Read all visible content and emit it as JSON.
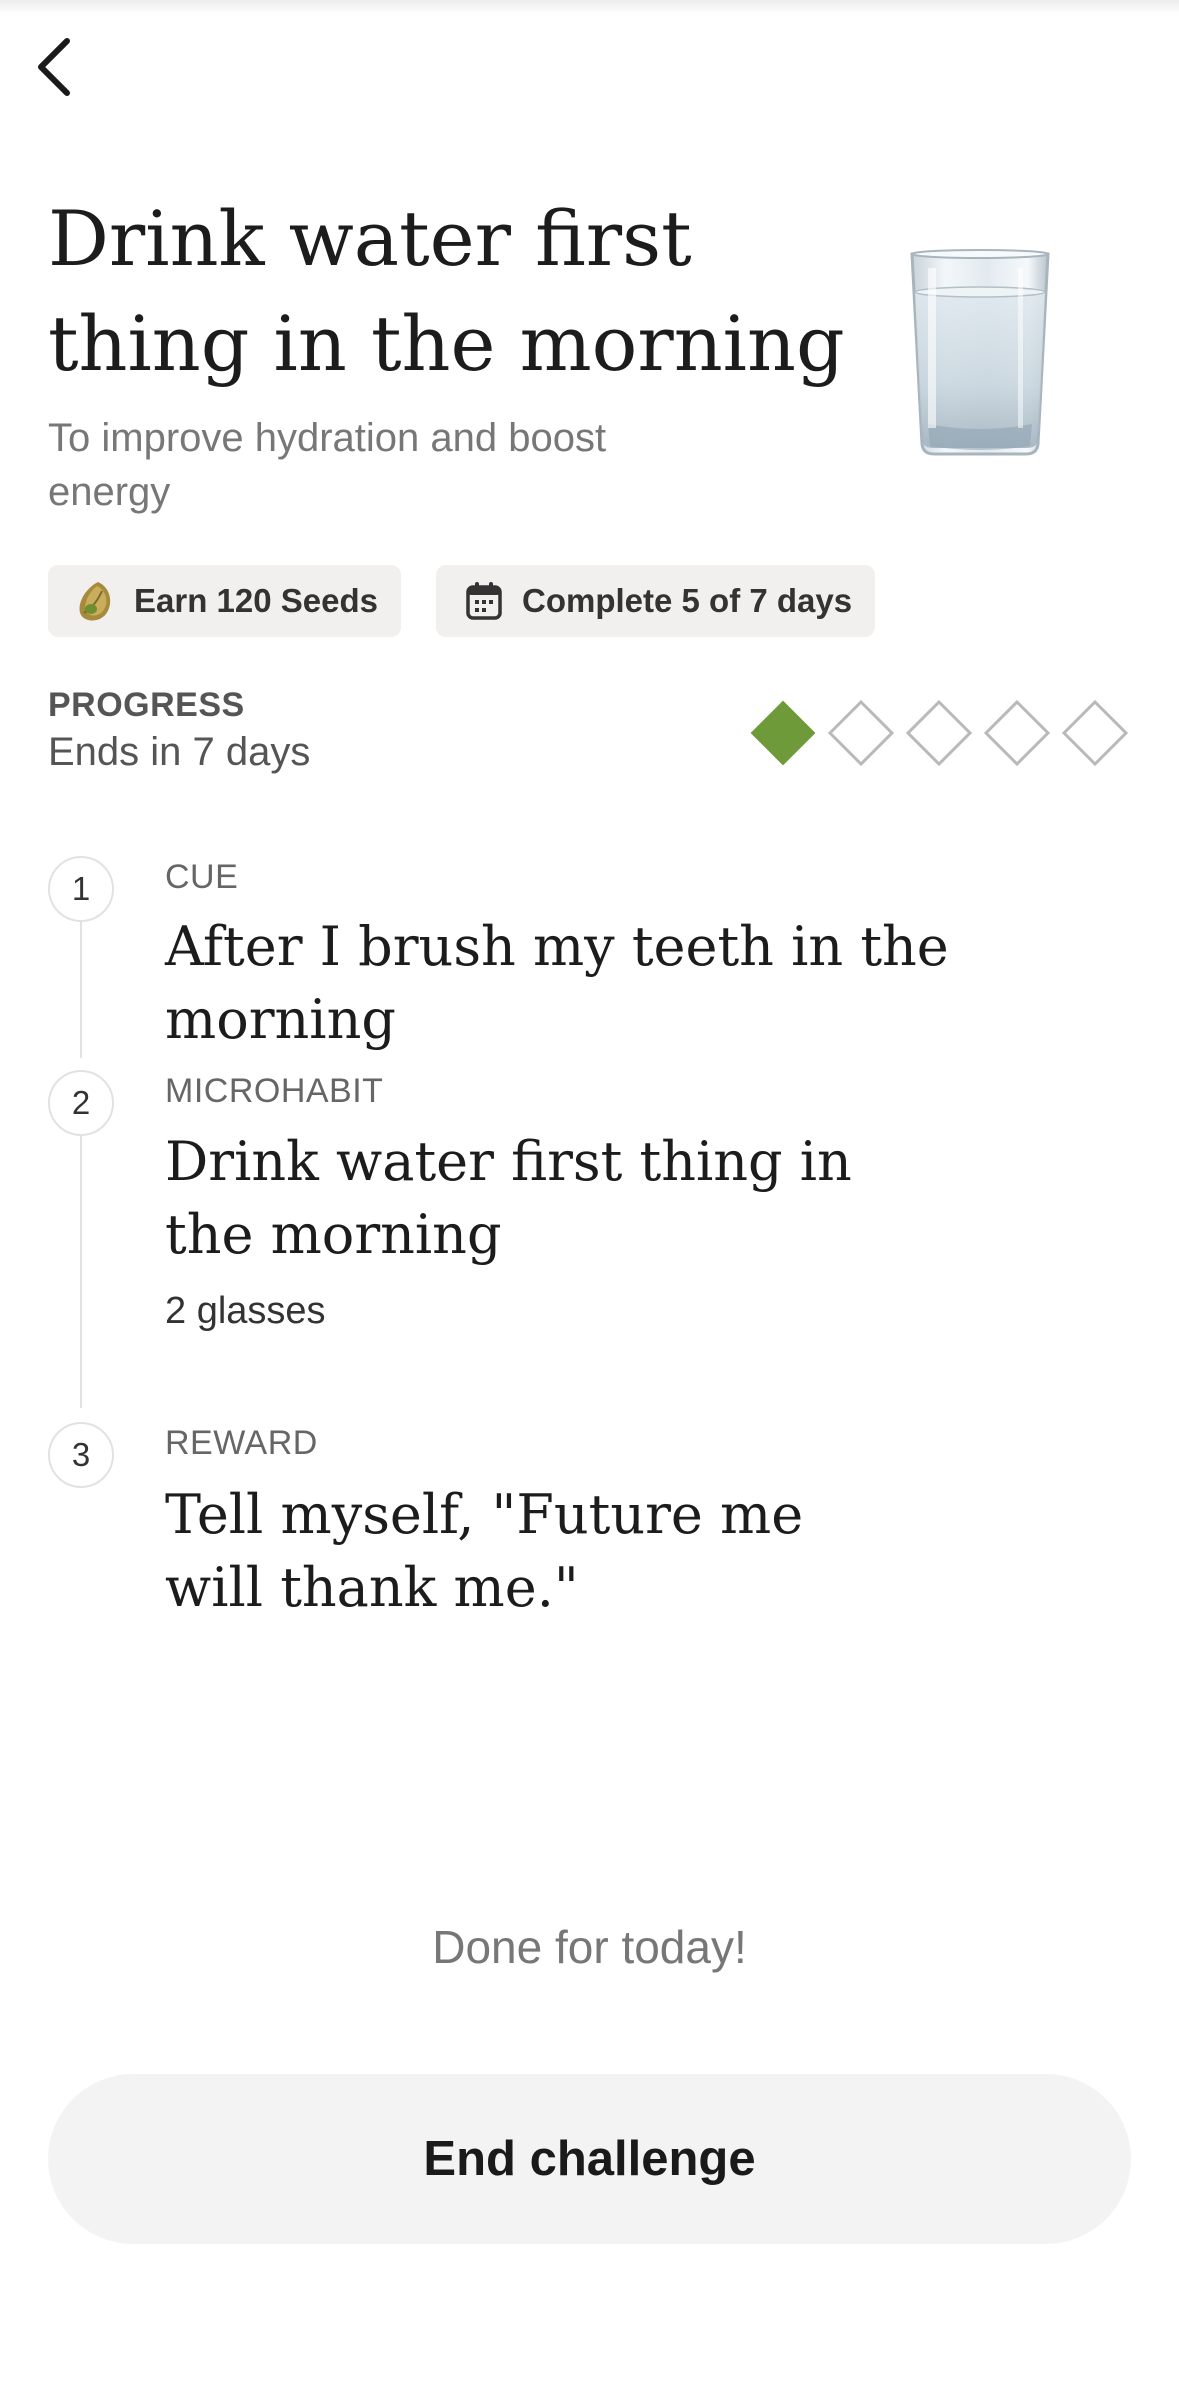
{
  "nav": {
    "back_icon": "chevron-left-icon"
  },
  "header": {
    "title": "Drink water first thing in the morning",
    "subtitle": "To improve hydration and boost energy",
    "image_icon": "water-glass-icon"
  },
  "chips": {
    "seeds": {
      "label": "Earn 120 Seeds",
      "icon": "seed-icon"
    },
    "days": {
      "label": "Complete 5 of 7 days",
      "icon": "calendar-icon"
    }
  },
  "progress": {
    "label": "PROGRESS",
    "ends": "Ends in 7 days",
    "completed": 1,
    "total": 5,
    "filled_color": "#6f9a3a",
    "empty_color": "#b9b9b9"
  },
  "steps": [
    {
      "number": "1",
      "label": "CUE",
      "text": "After I brush my teeth in the morning"
    },
    {
      "number": "2",
      "label": "MICROHABIT",
      "text": "Drink water first thing in the morning",
      "detail": "2 glasses"
    },
    {
      "number": "3",
      "label": "REWARD",
      "text": "Tell myself, \"Future me will thank me.\""
    }
  ],
  "footer": {
    "status": "Done for today!",
    "end_button": "End challenge"
  }
}
